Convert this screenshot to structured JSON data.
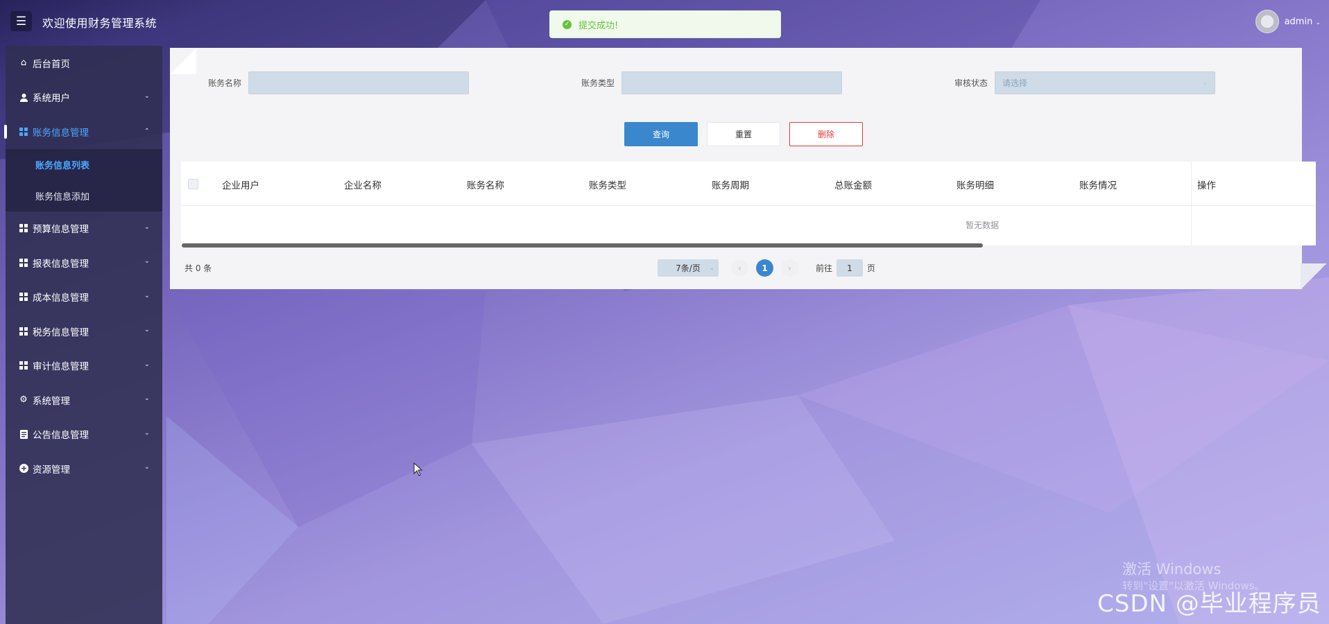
{
  "header": {
    "menu_toggle_icon": "hamburger-icon",
    "title": "欢迎使用财务管理系统",
    "user_name": "admin"
  },
  "toast": {
    "icon": "success-check-icon",
    "message": "提交成功!"
  },
  "sidebar": {
    "items": [
      {
        "label": "后台首页",
        "icon": "home-icon"
      },
      {
        "label": "系统用户",
        "icon": "user-icon"
      },
      {
        "label": "账务信息管理",
        "icon": "grid-icon",
        "expanded": true,
        "children": [
          {
            "label": "账务信息列表",
            "active": true
          },
          {
            "label": "账务信息添加"
          }
        ]
      },
      {
        "label": "预算信息管理",
        "icon": "grid-icon"
      },
      {
        "label": "报表信息管理",
        "icon": "grid-icon"
      },
      {
        "label": "成本信息管理",
        "icon": "grid-icon"
      },
      {
        "label": "税务信息管理",
        "icon": "grid-icon"
      },
      {
        "label": "审计信息管理",
        "icon": "grid-icon"
      },
      {
        "label": "系统管理",
        "icon": "gear-icon"
      },
      {
        "label": "公告信息管理",
        "icon": "document-icon"
      },
      {
        "label": "资源管理",
        "icon": "plus-circle-icon"
      }
    ]
  },
  "search": {
    "account_name_label": "账务名称",
    "account_name_value": "",
    "account_type_label": "账务类型",
    "account_type_value": "",
    "review_status_label": "审核状态",
    "review_status_placeholder": "请选择"
  },
  "buttons": {
    "query": "查询",
    "reset": "重置",
    "delete": "删除"
  },
  "table": {
    "columns": [
      "企业用户",
      "企业名称",
      "账务名称",
      "账务类型",
      "账务周期",
      "总账金额",
      "账务明细",
      "账务情况",
      "操作"
    ],
    "rows": [],
    "empty_text": "暂无数据"
  },
  "pagination": {
    "total_text": "共 0 条",
    "page_size": "7条/页",
    "current_page": "1",
    "goto_prefix": "前往",
    "goto_value": "1",
    "goto_suffix": "页"
  },
  "watermarks": {
    "windows_line1": "激活 Windows",
    "windows_line2": "转到\"设置\"以激活 Windows。",
    "csdn": "CSDN @毕业程序员"
  },
  "colors": {
    "accent": "#3a87ce",
    "danger": "#e53b3b",
    "success": "#67c23a",
    "sidebar_active": "#4aa8ff"
  }
}
